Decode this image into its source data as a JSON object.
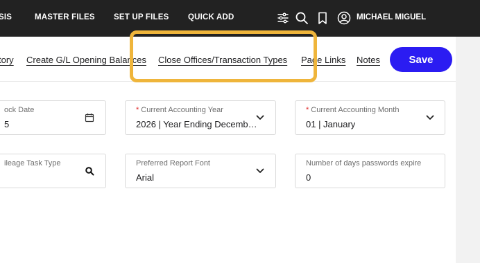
{
  "nav": {
    "items": [
      "SIS",
      "MASTER FILES",
      "SET UP FILES",
      "QUICK ADD"
    ],
    "icons": [
      "sliders-icon",
      "search-icon",
      "bookmark-icon",
      "user-avatar-icon"
    ],
    "user_name": "MICHAEL MIGUEL"
  },
  "tabs": {
    "links": [
      "tory",
      "Create G/L Opening Balances",
      "Close Offices/Transaction Types",
      "Page Links",
      "Notes"
    ],
    "save_label": "Save"
  },
  "fields": {
    "lock_date": {
      "label": "ock Date",
      "value": "5",
      "icon": "calendar-icon"
    },
    "current_accounting_year": {
      "label": "Current Accounting Year",
      "required": true,
      "value": "2026 | Year Ending Decembe…",
      "icon": "chevron-down-icon"
    },
    "current_accounting_month": {
      "label": "Current Accounting Month",
      "required": true,
      "value": "01 | January",
      "icon": "chevron-down-icon"
    },
    "mileage_task_type": {
      "label": "ileage Task Type",
      "value": "",
      "icon": "search-icon"
    },
    "preferred_report_font": {
      "label": "Preferred Report Font",
      "value": "Arial",
      "icon": "chevron-down-icon"
    },
    "password_expire_days": {
      "label": "Number of days passwords expire",
      "value": "0"
    }
  },
  "colors": {
    "topbar": "#222222",
    "accent": "#2b1cf2",
    "highlight": "#efb53b",
    "required": "#e02424"
  }
}
